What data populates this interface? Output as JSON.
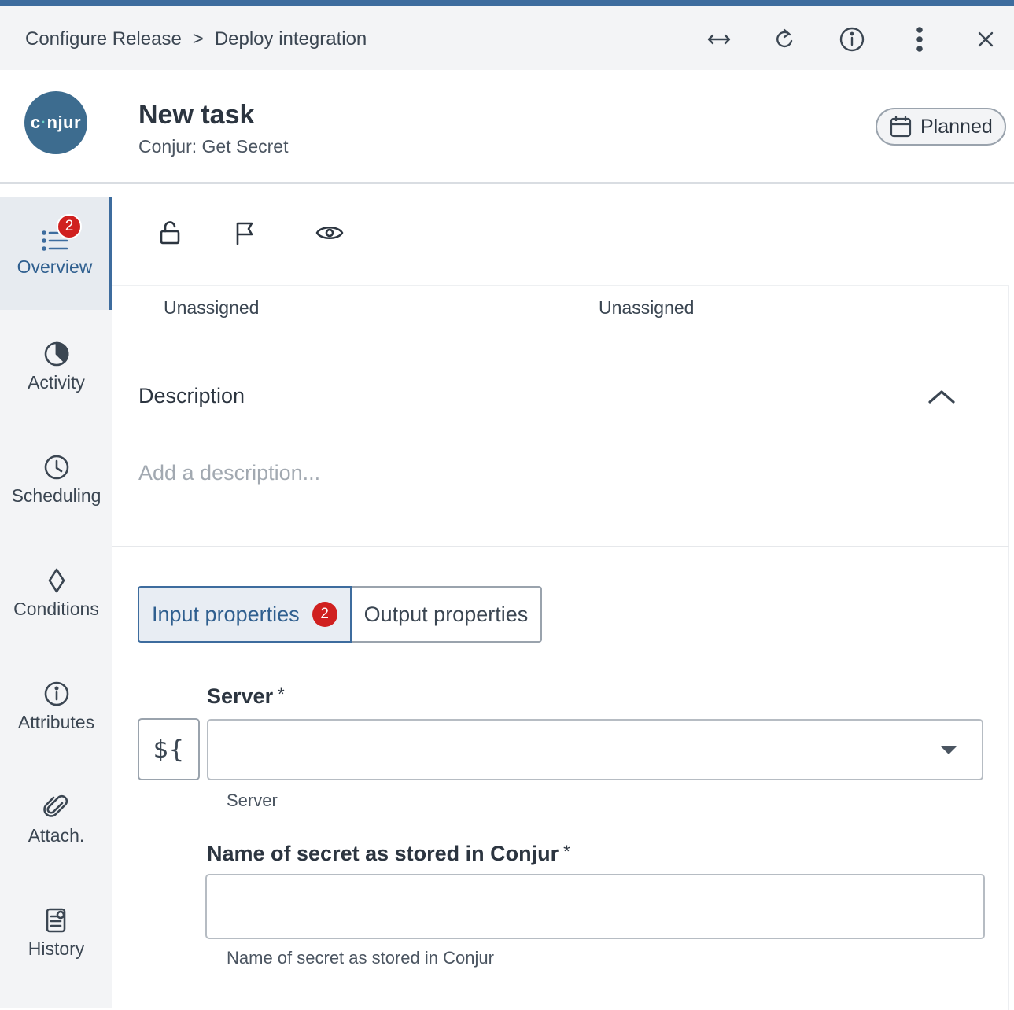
{
  "breadcrumb": {
    "parent": "Configure Release",
    "separator": ">",
    "current": "Deploy integration"
  },
  "header_icons": [
    "expand-horizontal-icon",
    "refresh-icon",
    "info-icon",
    "more-vertical-icon",
    "close-icon"
  ],
  "task": {
    "logo_text_c": "c",
    "logo_text_rest": "njur",
    "title": "New task",
    "subtitle": "Conjur: Get Secret",
    "status": "Planned"
  },
  "sidebar": {
    "items": [
      {
        "label": "Overview",
        "icon": "list-icon",
        "badge": "2",
        "active": true
      },
      {
        "label": "Activity",
        "icon": "pie-chart-icon"
      },
      {
        "label": "Scheduling",
        "icon": "clock-icon"
      },
      {
        "label": "Conditions",
        "icon": "diamond-icon"
      },
      {
        "label": "Attributes",
        "icon": "info-icon"
      },
      {
        "label": "Attach.",
        "icon": "paperclip-icon"
      },
      {
        "label": "History",
        "icon": "history-doc-icon"
      }
    ]
  },
  "toolbar": {
    "icons": [
      "unlock-icon",
      "flag-icon",
      "eye-icon"
    ]
  },
  "assignees": {
    "owner": "Unassigned",
    "team": "Unassigned"
  },
  "description": {
    "title": "Description",
    "placeholder": "Add a description..."
  },
  "tabs": {
    "input": "Input properties",
    "input_badge": "2",
    "output": "Output properties"
  },
  "fields": {
    "server": {
      "label": "Server",
      "required": "*",
      "helper": "Server",
      "value": "",
      "variable_button": "${"
    },
    "secret": {
      "label": "Name of secret as stored in Conjur",
      "required": "*",
      "helper": "Name of secret as stored in Conjur",
      "value": ""
    }
  },
  "colors": {
    "accent": "#3d6c9e",
    "badge": "#d0201f",
    "logo_bg": "#3d6c8f"
  }
}
